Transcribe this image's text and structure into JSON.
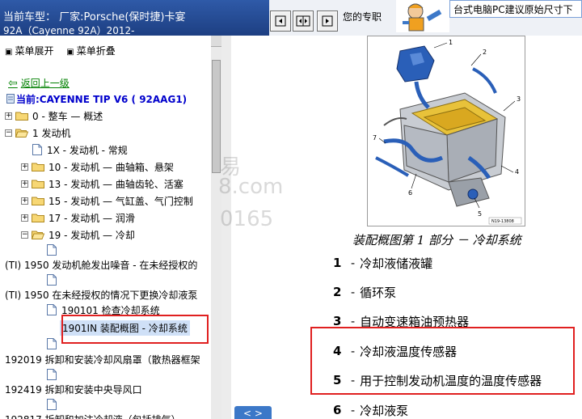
{
  "header": {
    "vehicle_line1": "当前车型：  厂家:Porsche(保时捷)卡宴",
    "vehicle_line2": "92A（Cayenne 92A）2012-",
    "notice_text": "您的专职",
    "ad_text": "台式电脑PC建议原始尺寸下"
  },
  "toolbar": {
    "buttons": [
      {
        "icon": "prev-page-icon"
      },
      {
        "icon": "toggle-split-icon"
      },
      {
        "icon": "next-page-icon"
      }
    ]
  },
  "tree": {
    "expand_all": "菜单展开",
    "collapse_all": "菜单折叠",
    "back_label": "返回上一级",
    "current_label": "当前:CAYENNE TIP V6 ( 92AAG1)",
    "items": [
      {
        "label": "0 - 整车 — 概述"
      },
      {
        "label": "1 发动机"
      },
      {
        "label": "1X - 发动机 - 常规"
      },
      {
        "label": "10 - 发动机 — 曲轴箱、悬架"
      },
      {
        "label": "13 - 发动机 — 曲轴齿轮、活塞"
      },
      {
        "label": "15 - 发动机 — 气缸盖、气门控制"
      },
      {
        "label": "17 - 发动机 — 润滑"
      },
      {
        "label": "19 - 发动机 — 冷却"
      },
      {
        "label": "(TI) 1950 发动机舱发出噪音 - 在未经授权的"
      },
      {
        "label": "(TI) 1950 在未经授权的情况下更换冷却液泵"
      },
      {
        "label": "190101 检查冷却系统"
      },
      {
        "label": "1901IN 装配概图 - 冷却系统"
      },
      {
        "label": "192019 拆卸和安装冷却风扇罩（散热器框架"
      },
      {
        "label": "192419 拆卸和安装中央导风口"
      },
      {
        "label": "192817 拆卸和加注冷却液（包括排气）"
      }
    ]
  },
  "diagram": {
    "callouts": [
      "1",
      "2",
      "3",
      "4",
      "5",
      "6",
      "7"
    ],
    "figure_code": "N19-13808"
  },
  "content": {
    "caption": "装配概图第 1 部分  －  冷却系统",
    "legend": [
      {
        "num": "1",
        "text": "冷却液储液罐"
      },
      {
        "num": "2",
        "text": "循环泵"
      },
      {
        "num": "3",
        "text": "自动变速箱油预热器"
      },
      {
        "num": "4",
        "text": "冷却液温度传感器"
      },
      {
        "num": "5",
        "text": "用于控制发动机温度的温度传感器"
      },
      {
        "num": "6",
        "text": "冷却液泵"
      }
    ],
    "nav_label": "< >"
  },
  "watermarks": [
    "易",
    "8.com",
    "0165"
  ],
  "colors": {
    "header_blue": "#1d3f82",
    "link_green": "#008000",
    "current_blue": "#0000cc",
    "highlight_red": "#e02020",
    "engine_blue": "#2a5fb8",
    "engine_yellow": "#e8c23a"
  }
}
